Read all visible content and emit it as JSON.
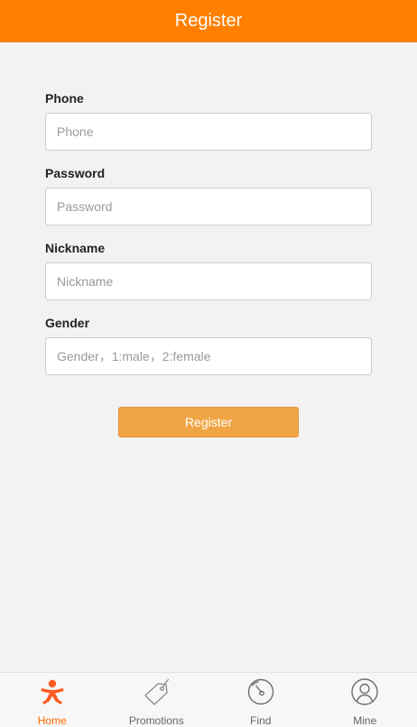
{
  "header": {
    "title": "Register"
  },
  "form": {
    "phone": {
      "label": "Phone",
      "placeholder": "Phone",
      "value": ""
    },
    "password": {
      "label": "Password",
      "placeholder": "Password",
      "value": ""
    },
    "nickname": {
      "label": "Nickname",
      "placeholder": "Nickname",
      "value": ""
    },
    "gender": {
      "label": "Gender",
      "placeholder": "Gender，1:male，2:female",
      "value": ""
    },
    "submit_label": "Register"
  },
  "tabbar": {
    "active": "home",
    "items": [
      {
        "id": "home",
        "label": "Home",
        "icon": "person-icon"
      },
      {
        "id": "promotions",
        "label": "Promotions",
        "icon": "tag-icon"
      },
      {
        "id": "find",
        "label": "Find",
        "icon": "compass-icon"
      },
      {
        "id": "mine",
        "label": "Mine",
        "icon": "user-circle-icon"
      }
    ]
  },
  "colors": {
    "header_bg": "#ff7f00",
    "button_bg": "#f0a545",
    "active_tab": "#ff6a00",
    "inactive_tab": "#666666",
    "page_bg": "#f2f2f2"
  }
}
